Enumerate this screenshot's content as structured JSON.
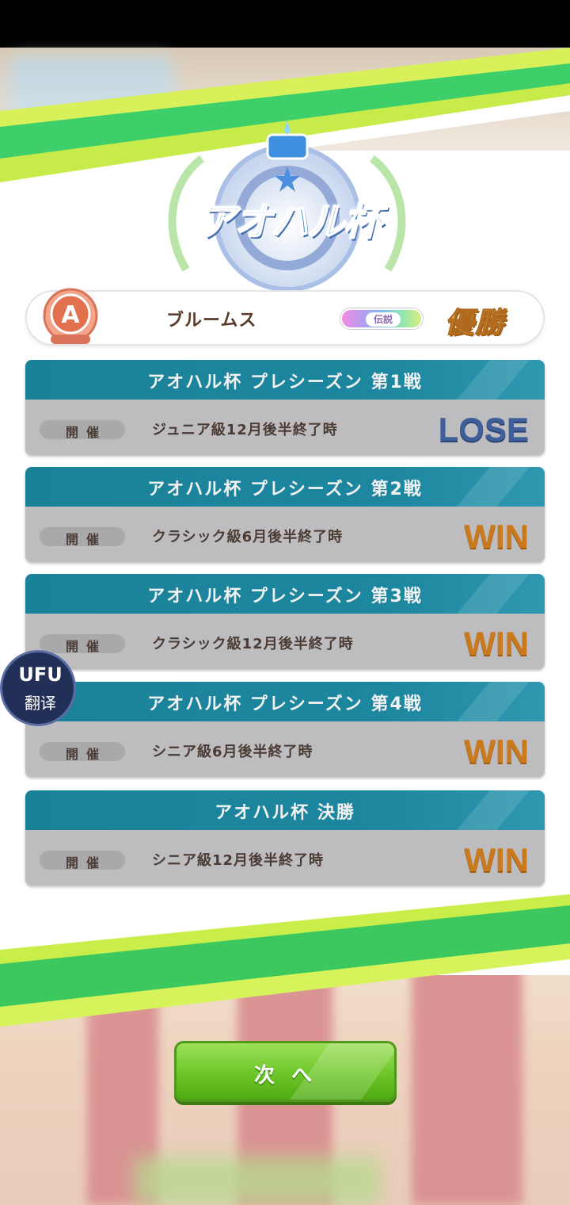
{
  "event": {
    "logo_title": "アオハル杯"
  },
  "team": {
    "rank": "A",
    "name": "ブルームス",
    "tier_badge": "伝説",
    "result_label": "優勝"
  },
  "races": [
    {
      "title": "アオハル杯 プレシーズン 第1戦",
      "held_label": "開催",
      "timing": "ジュニア級12月後半終了時",
      "result": "LOSE"
    },
    {
      "title": "アオハル杯 プレシーズン 第2戦",
      "held_label": "開催",
      "timing": "クラシック級6月後半終了時",
      "result": "WIN"
    },
    {
      "title": "アオハル杯 プレシーズン 第3戦",
      "held_label": "開催",
      "timing": "クラシック級12月後半終了時",
      "result": "WIN"
    },
    {
      "title": "アオハル杯 プレシーズン 第4戦",
      "held_label": "開催",
      "timing": "シニア級6月後半終了時",
      "result": "WIN"
    },
    {
      "title": "アオハル杯 決勝",
      "held_label": "開催",
      "timing": "シニア級12月後半終了時",
      "result": "WIN"
    }
  ],
  "translator": {
    "logo": "UFU",
    "label": "翻译"
  },
  "next_button": {
    "label": "次 へ"
  },
  "colors": {
    "header_teal": "#1a8298",
    "win": "#c97a1f",
    "lose": "#3f5f9a",
    "accent_green": "#5cc43a"
  }
}
